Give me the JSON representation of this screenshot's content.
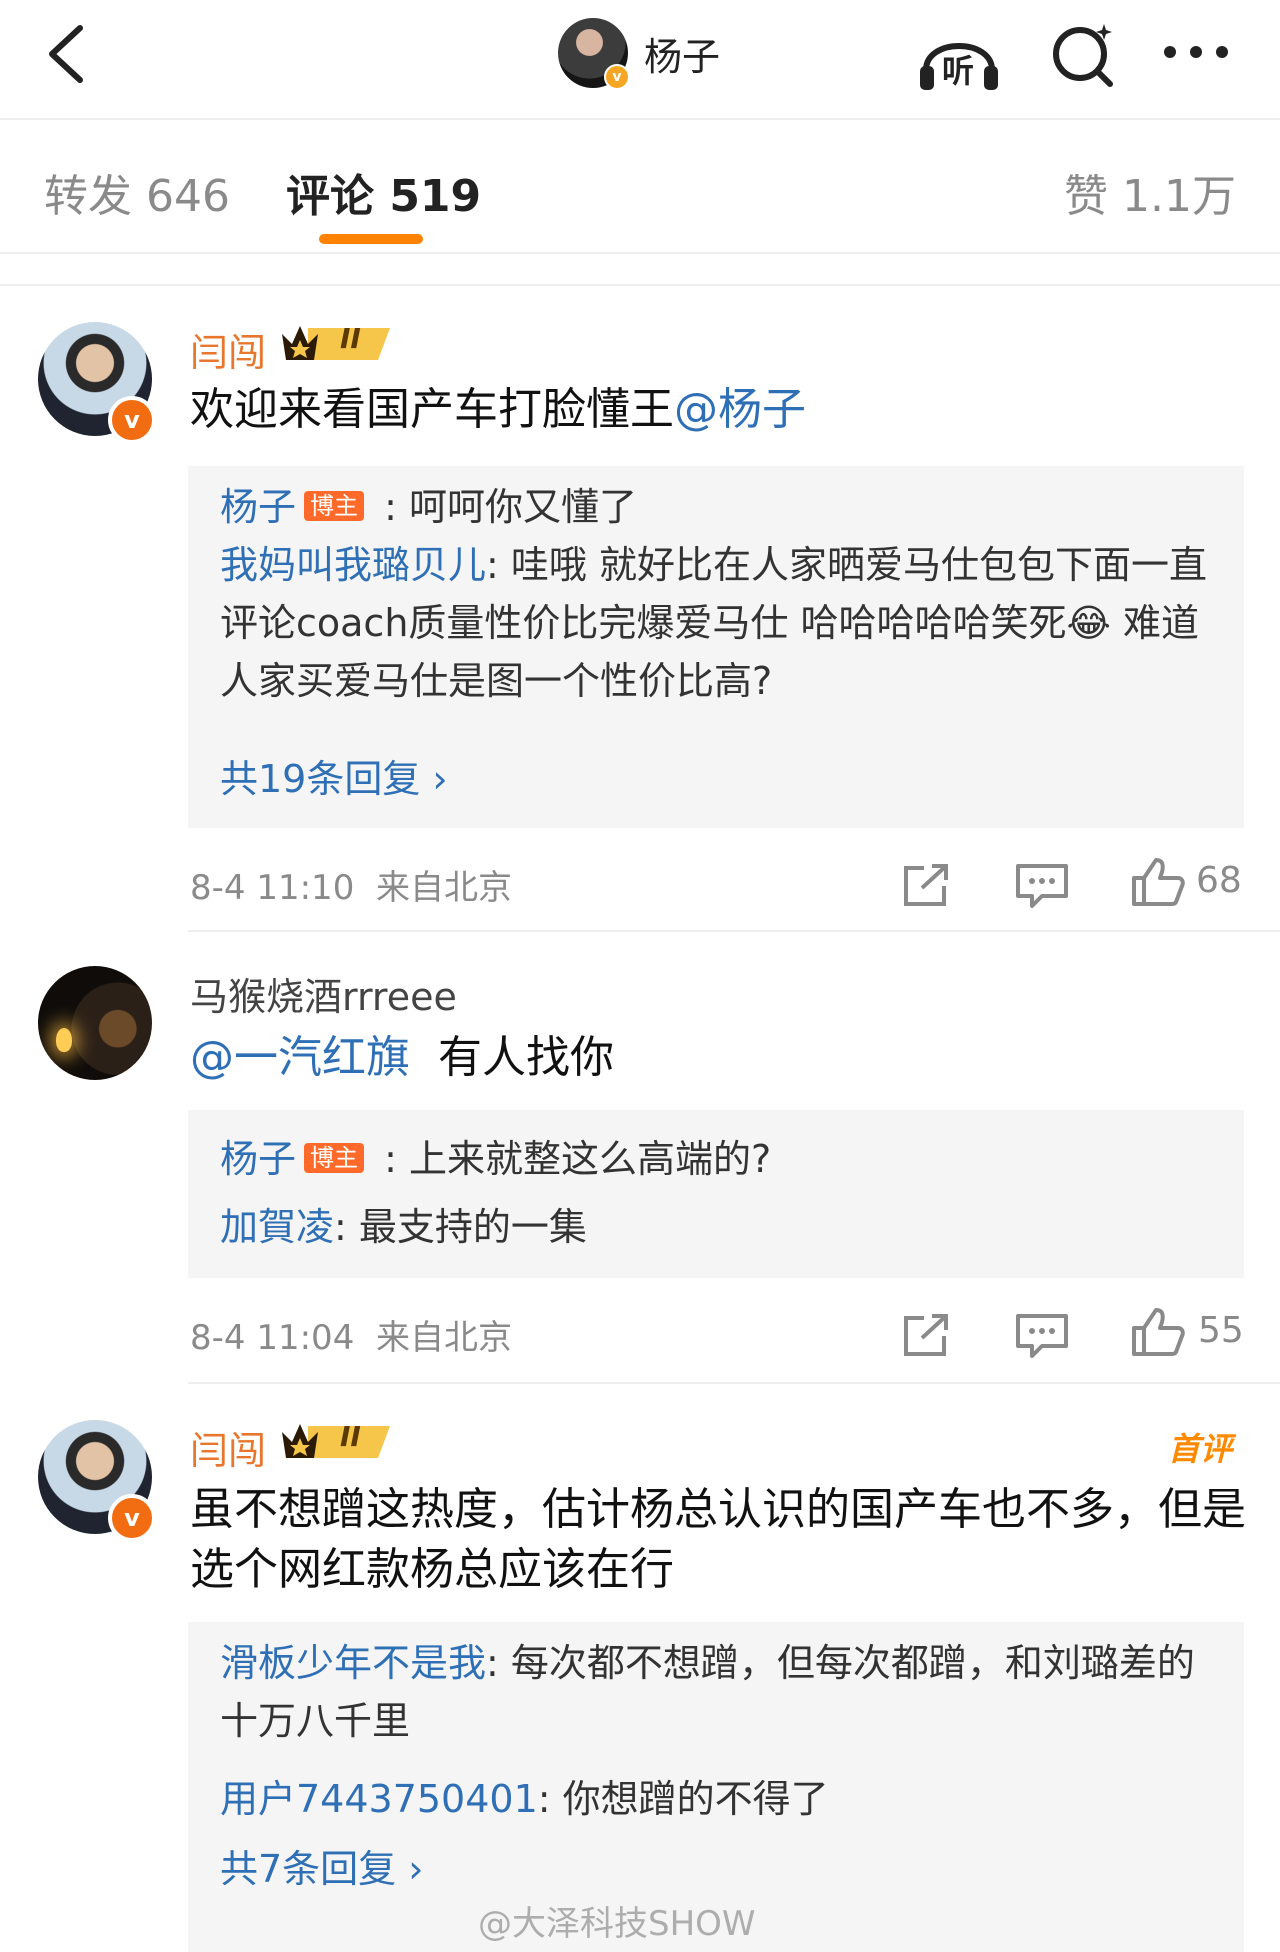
{
  "header": {
    "user_name": "杨子",
    "verified_badge": "v",
    "icons": [
      "back-arrow-icon",
      "listen-headphones-icon",
      "search-icon",
      "more-dots-icon"
    ],
    "listen_label": "听"
  },
  "tabs": {
    "forward": "转发 646",
    "comment": "评论 519",
    "like": "赞 1.1万",
    "active": "comment",
    "accent_color": "#ff8200"
  },
  "comments": [
    {
      "user": "闫闯",
      "avatar": "man-portrait",
      "verified": "v",
      "crown_level": "II",
      "text": "欢迎来看国产车打脸懂王",
      "mention": "@杨子",
      "replies": [
        {
          "name": "杨子",
          "host_tag": "博主",
          "sep": " : ",
          "text": "呵呵你又懂了"
        },
        {
          "name": "我妈叫我璐贝儿",
          "sep": ": ",
          "text": "哇哦 就好比在人家晒爱马仕包包下面一直评论coach质量性价比完爆爱马仕 哈哈哈哈哈笑死😂 难道人家买爱马仕是图一个性价比高?"
        }
      ],
      "more_replies": "共19条回复 ›",
      "time": "8-4 11:10",
      "location": "来自北京",
      "likes": "68"
    },
    {
      "user": "马猴烧酒rrreee",
      "avatar": "dark-candle",
      "mention": "@一汽红旗",
      "text": "有人找你",
      "replies": [
        {
          "name": "杨子",
          "host_tag": "博主",
          "sep": " : ",
          "text": "上来就整这么高端的?"
        },
        {
          "name": "加賀凌",
          "sep": ": ",
          "text": "最支持的一集"
        }
      ],
      "time": "8-4 11:04",
      "location": "来自北京",
      "likes": "55"
    },
    {
      "user": "闫闯",
      "avatar": "man-portrait",
      "verified": "v",
      "crown_level": "II",
      "first_comment_tag": "首评",
      "text": "虽不想蹭这热度，估计杨总认识的国产车也不多，但是选个网红款杨总应该在行",
      "replies": [
        {
          "name": "滑板少年不是我",
          "sep": ": ",
          "text": "每次都不想蹭，但每次都蹭，和刘璐差的十万八千里"
        },
        {
          "name": "用户7443750401",
          "sep": ": ",
          "text": "你想蹭的不得了"
        }
      ],
      "more_replies": "共7条回复 ›"
    }
  ],
  "watermark": "@大泽科技SHOW",
  "colors": {
    "link": "#2f6fb5",
    "gold_name": "#e8762d",
    "meta": "#8a8a8a",
    "reply_bg": "#f5f5f5"
  }
}
